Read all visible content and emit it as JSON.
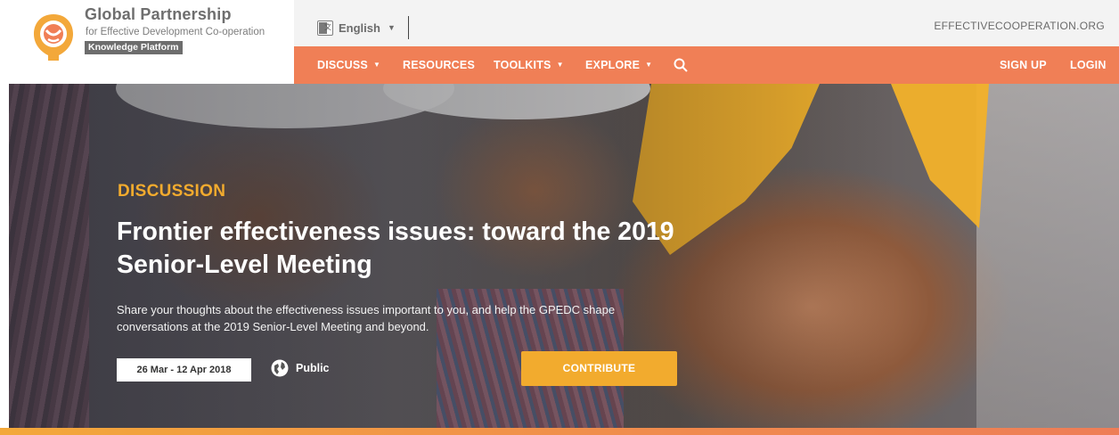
{
  "brand": {
    "title": "Global Partnership",
    "subtitle": "for Effective Development Co-operation",
    "platform_badge": "Knowledge Platform",
    "logo_icon": "gpedc-logo-icon"
  },
  "topbar": {
    "language": {
      "label": "English",
      "icon": "google-translate-icon"
    },
    "site_link": "EFFECTIVECOOPERATION.ORG"
  },
  "nav": {
    "items": [
      {
        "label": "DISCUSS",
        "dropdown": true
      },
      {
        "label": "RESOURCES",
        "dropdown": false
      },
      {
        "label": "TOOLKITS",
        "dropdown": true
      },
      {
        "label": "EXPLORE",
        "dropdown": true
      }
    ],
    "signup_label": "SIGN UP",
    "login_label": "LOGIN"
  },
  "hero": {
    "tag": "DISCUSSION",
    "title": "Frontier effectiveness issues: toward the 2019 Senior-Level Meeting",
    "description": "Share your thoughts about the effectiveness issues important to you, and help the GPEDC shape conversations at the 2019 Senior-Level Meeting and beyond.",
    "date_range": "26 Mar - 12 Apr 2018",
    "visibility": "Public",
    "visibility_icon": "globe-icon",
    "cta_label": "CONTRIBUTE"
  },
  "colors": {
    "nav_orange": "#f07f56",
    "accent_yellow": "#f2ab2e",
    "topbar_gray": "#f3f3f3"
  }
}
